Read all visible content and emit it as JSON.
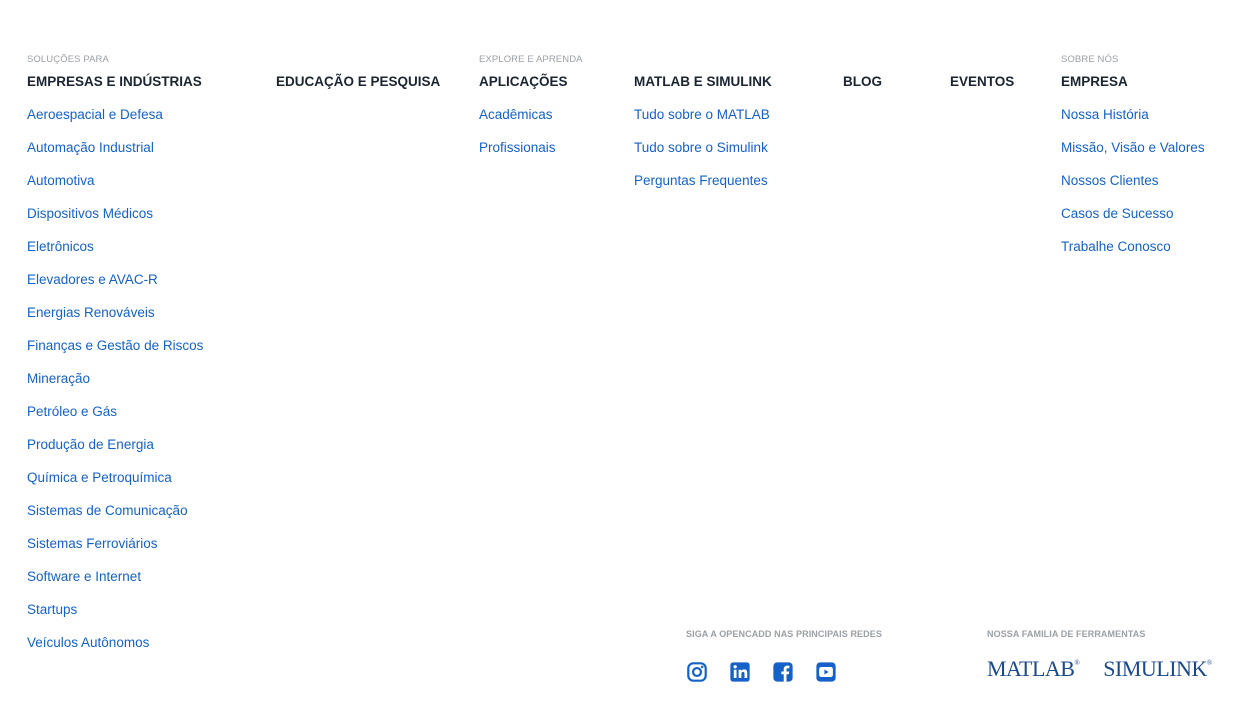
{
  "columns": {
    "industries": {
      "eyebrow": "SOLUÇÕES PARA",
      "heading": "EMPRESAS E INDÚSTRIAS",
      "items": [
        "Aeroespacial e Defesa",
        "Automação Industrial",
        "Automotiva",
        "Dispositivos Médicos",
        "Eletrônicos",
        "Elevadores e AVAC-R",
        "Energias Renováveis",
        "Finanças e Gestão de Riscos",
        "Mineração",
        "Petróleo e Gás",
        "Produção de Energia",
        "Química e Petroquímica",
        "Sistemas de Comunicação",
        "Sistemas Ferroviários",
        "Software e Internet",
        "Startups",
        "Veículos Autônomos"
      ]
    },
    "education": {
      "heading": "EDUCAÇÃO E PESQUISA"
    },
    "applications": {
      "eyebrow": "EXPLORE E APRENDA",
      "heading": "APLICAÇÕES",
      "items": [
        "Acadêmicas",
        "Profissionais"
      ]
    },
    "matlab": {
      "heading": "MATLAB E SIMULINK",
      "items": [
        "Tudo sobre o MATLAB",
        "Tudo sobre o Simulink",
        "Perguntas Frequentes"
      ]
    },
    "blog": {
      "heading": "BLOG"
    },
    "events": {
      "heading": "EVENTOS"
    },
    "company": {
      "eyebrow": "SOBRE NÓS",
      "heading": "EMPRESA",
      "items": [
        "Nossa História",
        "Missão, Visão e Valores",
        "Nossos Clientes",
        "Casos de Sucesso",
        "Trabalhe Conosco"
      ]
    }
  },
  "social": {
    "label": "SIGA A OPENCADD NAS PRINCIPAIS REDES",
    "icons": [
      "instagram-icon",
      "linkedin-icon",
      "facebook-icon",
      "youtube-icon"
    ]
  },
  "family": {
    "label": "NOSSA FAMILIA DE FERRAMENTAS",
    "brands": [
      "MATLAB",
      "SIMULINK"
    ],
    "trademark": "®"
  },
  "colors": {
    "link": "#1462c8",
    "heading": "#1b2431",
    "muted": "#9aa0a6",
    "icon": "#1462c8"
  }
}
